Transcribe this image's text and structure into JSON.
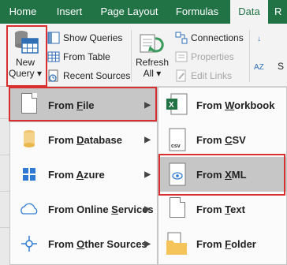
{
  "tabs": [
    "Home",
    "Insert",
    "Page Layout",
    "Formulas",
    "Data",
    "R"
  ],
  "ribbon": {
    "new_query": {
      "line1": "New",
      "line2": "Query ▾"
    },
    "get_transform": [
      "Show Queries",
      "From Table",
      "Recent Sources"
    ],
    "refresh": {
      "line1": "Refresh",
      "line2": "All ▾"
    },
    "connections": [
      "Connections",
      "Properties",
      "Edit Links"
    ],
    "right_partial": [
      "S",
      "S"
    ]
  },
  "menu_primary": [
    {
      "label_bold": "From ",
      "label_u": "F",
      "label_rest": "ile",
      "icon": "file-icon"
    },
    {
      "label_bold": "From ",
      "label_u": "D",
      "label_rest": "atabase",
      "icon": "database-icon"
    },
    {
      "label_bold": "From ",
      "label_u": "A",
      "label_rest": "zure",
      "icon": "azure-icon"
    },
    {
      "label_bold": "From Online ",
      "label_u": "S",
      "label_rest": "ervices",
      "icon": "cloud-icon"
    },
    {
      "label_bold": "From ",
      "label_u": "O",
      "label_rest": "ther Sources",
      "icon": "other-sources-icon"
    }
  ],
  "menu_secondary": [
    {
      "label_bold": "From ",
      "label_u": "W",
      "label_rest": "orkbook",
      "icon": "excel-workbook-icon"
    },
    {
      "label_bold": "From ",
      "label_u": "C",
      "label_rest": "SV",
      "icon": "csv-icon"
    },
    {
      "label_bold": "From ",
      "label_u": "X",
      "label_rest": "ML",
      "icon": "xml-icon"
    },
    {
      "label_bold": "From ",
      "label_u": "T",
      "label_rest": "ext",
      "icon": "text-file-icon"
    },
    {
      "label_bold": "From ",
      "label_u": "F",
      "label_rest": "older",
      "icon": "folder-icon"
    }
  ],
  "icon_labels": {
    "csv": "csv"
  },
  "colors": {
    "excel_green": "#217346",
    "highlight": "#c6c6c6",
    "annotation_red": "#d9302f"
  }
}
